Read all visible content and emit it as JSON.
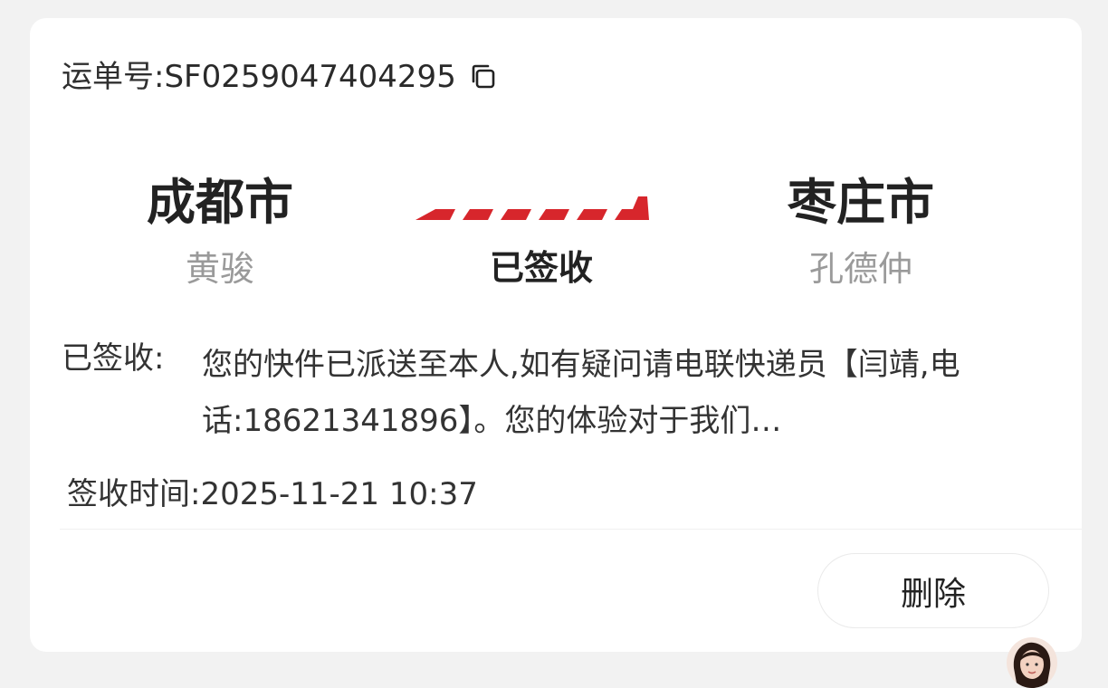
{
  "waybill": {
    "label": "运单号:",
    "number": "SF0259047404295",
    "copy_icon": "copy-icon"
  },
  "route": {
    "from_city": "成都市",
    "from_person": "黄骏",
    "to_city": "枣庄市",
    "to_person": "孔德仲",
    "status": "已签收",
    "arrow_color": "#d7262c"
  },
  "detail": {
    "label": "已签收:",
    "text": "您的快件已派送至本人,如有疑问请电联快递员【闫靖,电话:18621341896】。您的体验对于我们…"
  },
  "sign_time": {
    "text": "签收时间:2025-11-21 10:37"
  },
  "actions": {
    "delete_label": "删除"
  },
  "colors": {
    "accent": "#d7262c",
    "muted": "#9a9a9a",
    "text": "#222222"
  }
}
